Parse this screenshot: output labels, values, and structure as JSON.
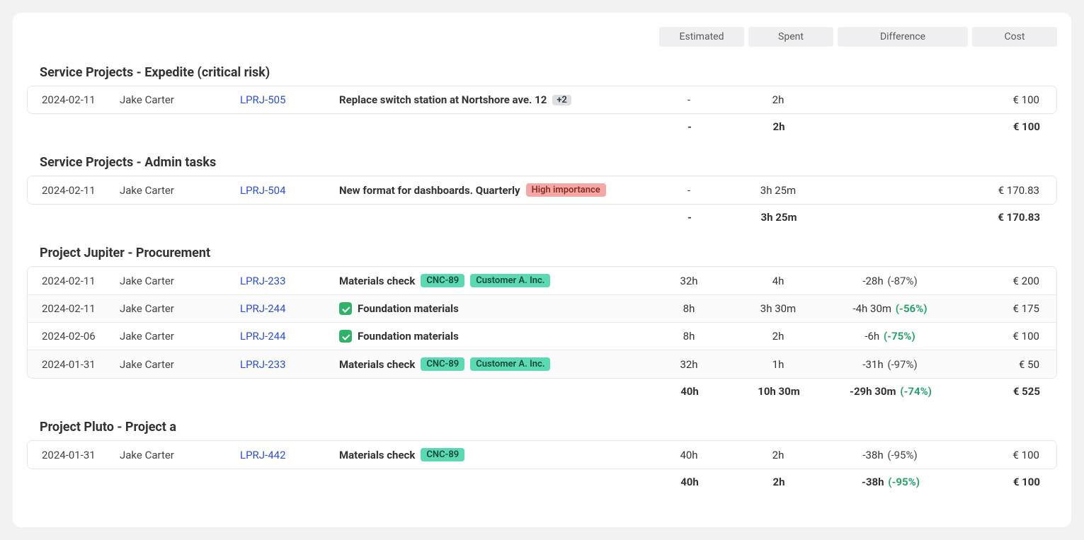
{
  "headers": {
    "estimated": "Estimated",
    "spent": "Spent",
    "difference": "Difference",
    "cost": "Cost"
  },
  "groups": [
    {
      "title": "Service Projects - Expedite (critical risk)",
      "rows": [
        {
          "date": "2024-02-11",
          "user": "Jake Carter",
          "key": "LPRJ-505",
          "task": "Replace switch station at Nortshore ave. 12",
          "badges": [
            {
              "type": "count",
              "text": "+2"
            }
          ],
          "checkbox": false,
          "estimated": "-",
          "spent": "2h",
          "diff_value": "",
          "diff_pct": "",
          "diff_pct_green": false,
          "cost": "€ 100"
        }
      ],
      "total": {
        "estimated": "-",
        "spent": "2h",
        "diff_value": "",
        "diff_pct": "",
        "diff_pct_green": false,
        "cost": "€ 100"
      }
    },
    {
      "title": "Service Projects - Admin tasks",
      "rows": [
        {
          "date": "2024-02-11",
          "user": "Jake Carter",
          "key": "LPRJ-504",
          "task": "New format for dashboards. Quarterly",
          "badges": [
            {
              "type": "red",
              "text": "High importance"
            }
          ],
          "checkbox": false,
          "estimated": "-",
          "spent": "3h 25m",
          "diff_value": "",
          "diff_pct": "",
          "diff_pct_green": false,
          "cost": "€ 170.83"
        }
      ],
      "total": {
        "estimated": "-",
        "spent": "3h 25m",
        "diff_value": "",
        "diff_pct": "",
        "diff_pct_green": false,
        "cost": "€ 170.83"
      }
    },
    {
      "title": "Project Jupiter - Procurement",
      "rows": [
        {
          "date": "2024-02-11",
          "user": "Jake Carter",
          "key": "LPRJ-233",
          "task": "Materials check",
          "badges": [
            {
              "type": "teal",
              "text": "CNC-89"
            },
            {
              "type": "teal",
              "text": "Customer A. Inc."
            }
          ],
          "checkbox": false,
          "estimated": "32h",
          "spent": "4h",
          "diff_value": "-28h",
          "diff_pct": "(-87%)",
          "diff_pct_green": false,
          "cost": "€ 200"
        },
        {
          "date": "2024-02-11",
          "user": "Jake Carter",
          "key": "LPRJ-244",
          "task": "Foundation materials",
          "badges": [],
          "checkbox": true,
          "estimated": "8h",
          "spent": "3h 30m",
          "diff_value": "-4h 30m",
          "diff_pct": "(-56%)",
          "diff_pct_green": true,
          "cost": "€ 175"
        },
        {
          "date": "2024-02-06",
          "user": "Jake Carter",
          "key": "LPRJ-244",
          "task": "Foundation materials",
          "badges": [],
          "checkbox": true,
          "estimated": "8h",
          "spent": "2h",
          "diff_value": "-6h",
          "diff_pct": "(-75%)",
          "diff_pct_green": true,
          "cost": "€ 100"
        },
        {
          "date": "2024-01-31",
          "user": "Jake Carter",
          "key": "LPRJ-233",
          "task": "Materials check",
          "badges": [
            {
              "type": "teal",
              "text": "CNC-89"
            },
            {
              "type": "teal",
              "text": "Customer A. Inc."
            }
          ],
          "checkbox": false,
          "estimated": "32h",
          "spent": "1h",
          "diff_value": "-31h",
          "diff_pct": "(-97%)",
          "diff_pct_green": false,
          "cost": "€ 50"
        }
      ],
      "total": {
        "estimated": "40h",
        "spent": "10h 30m",
        "diff_value": "-29h 30m",
        "diff_pct": "(-74%)",
        "diff_pct_green": true,
        "cost": "€ 525"
      }
    },
    {
      "title": "Project Pluto - Project a",
      "rows": [
        {
          "date": "2024-01-31",
          "user": "Jake Carter",
          "key": "LPRJ-442",
          "task": "Materials check",
          "badges": [
            {
              "type": "teal",
              "text": "CNC-89"
            }
          ],
          "checkbox": false,
          "estimated": "40h",
          "spent": "2h",
          "diff_value": "-38h",
          "diff_pct": "(-95%)",
          "diff_pct_green": false,
          "cost": "€ 100"
        }
      ],
      "total": {
        "estimated": "40h",
        "spent": "2h",
        "diff_value": "-38h",
        "diff_pct": "(-95%)",
        "diff_pct_green": true,
        "cost": "€ 100"
      }
    }
  ]
}
